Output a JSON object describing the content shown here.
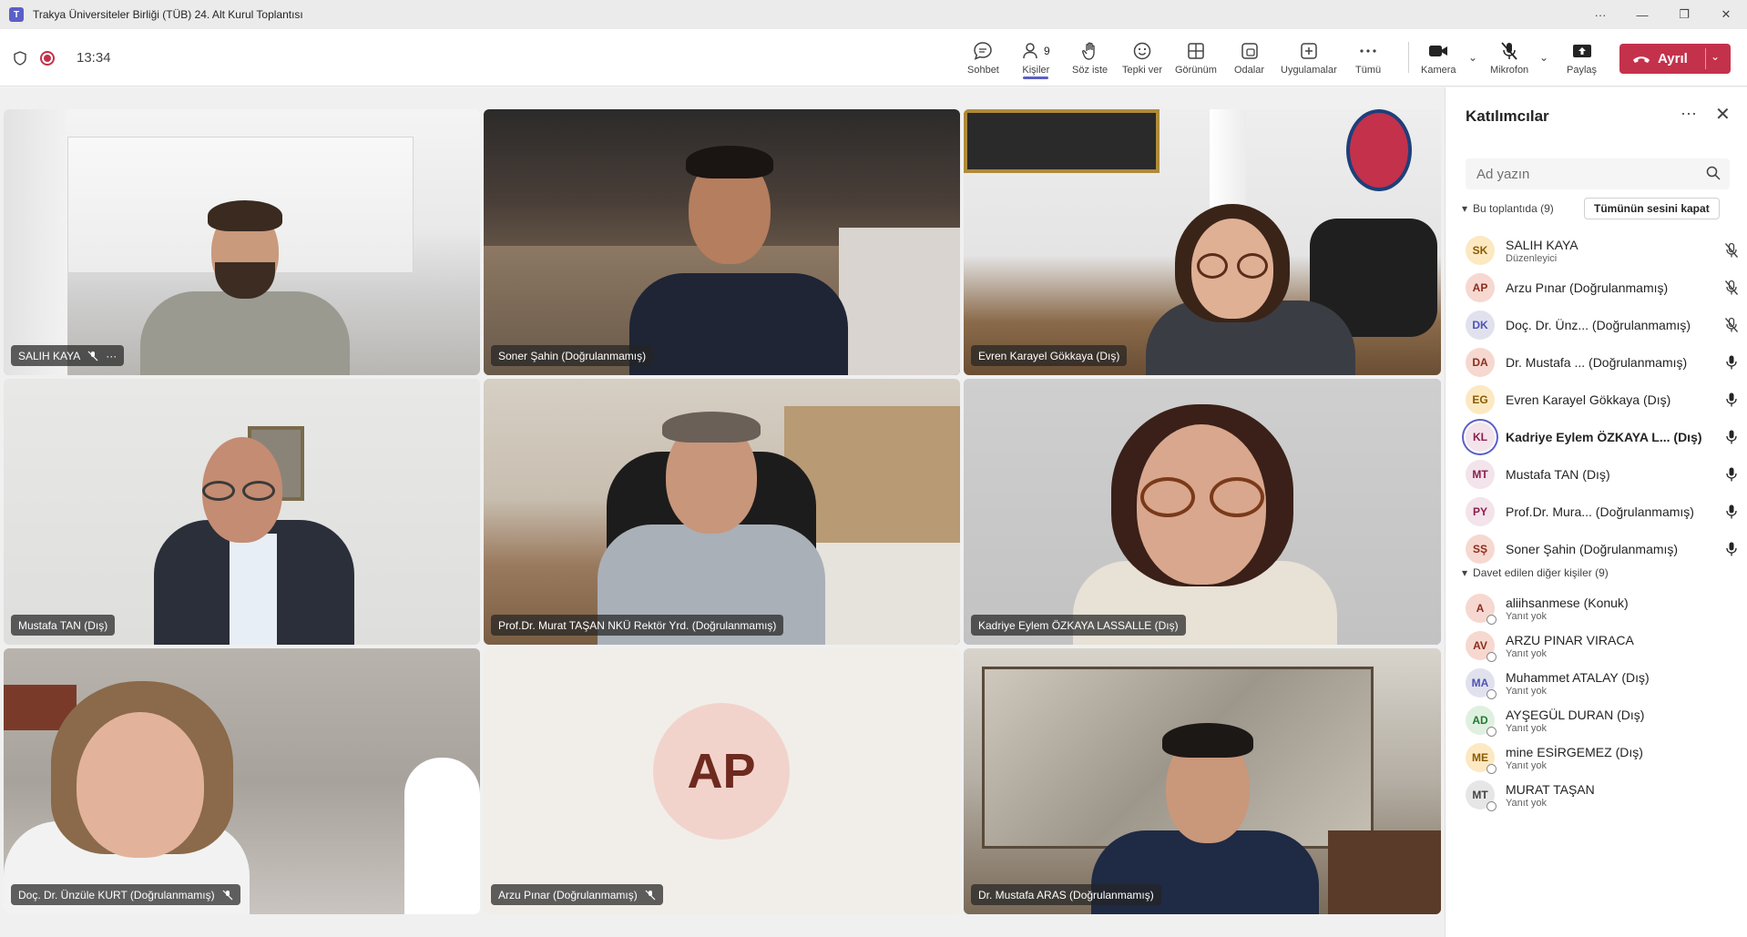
{
  "window": {
    "title": "Trakya Üniversiteler Birliği (TÜB) 24. Alt Kurul Toplantısı",
    "controls": [
      "···",
      "—",
      "❐",
      "✕"
    ]
  },
  "meeting": {
    "timer": "13:34"
  },
  "toolbar": {
    "chat": "Sohbet",
    "people": "Kişiler",
    "people_count": "9",
    "raise_hand": "Söz iste",
    "react": "Tepki ver",
    "view": "Görünüm",
    "rooms": "Odalar",
    "apps": "Uygulamalar",
    "more": "Tümü",
    "camera": "Kamera",
    "mic": "Mikrofon",
    "share": "Paylaş",
    "leave": "Ayrıl"
  },
  "tiles": [
    {
      "name": "SALIH KAYA"
    },
    {
      "name": "Soner Şahin (Doğrulanmamış)"
    },
    {
      "name": "Evren Karayel Gökkaya (Dış)"
    },
    {
      "name": "Mustafa TAN (Dış)"
    },
    {
      "name": "Prof.Dr. Murat TAŞAN NKÜ Rektör Yrd. (Doğrulanmamış)"
    },
    {
      "name": "Kadriye Eylem ÖZKAYA LASSALLE (Dış)"
    },
    {
      "name": "Doç. Dr. Ünzüle KURT (Doğrulanmamış)"
    },
    {
      "name": "Arzu Pınar (Doğrulanmamış)",
      "initials": "AP"
    },
    {
      "name": "Dr. Mustafa ARAS (Doğrulanmamış)"
    }
  ],
  "panel": {
    "title": "Katılımcılar",
    "search_placeholder": "Ad yazın",
    "in_meeting_label": "Bu toplantıda (9)",
    "mute_all": "Tümünün sesini kapat",
    "in_meeting": [
      {
        "initials": "SK",
        "name": "SALIH KAYA",
        "sub": "Düzenleyici",
        "bg": "#fce9c2",
        "fg": "#8a5a00",
        "mic": "muted"
      },
      {
        "initials": "AP",
        "name": "Arzu Pınar (Doğrulanmamış)",
        "bg": "#f6d8d0",
        "fg": "#8a2d1f",
        "mic": "muted"
      },
      {
        "initials": "DK",
        "name": "Doç. Dr. Ünz...  (Doğrulanmamış)",
        "bg": "#e1e1ee",
        "fg": "#4f52b2",
        "mic": "muted"
      },
      {
        "initials": "DA",
        "name": "Dr. Mustafa ...  (Doğrulanmamış)",
        "bg": "#f6d8d0",
        "fg": "#8a2d1f",
        "mic": "on"
      },
      {
        "initials": "EG",
        "name": "Evren Karayel Gökkaya (Dış)",
        "bg": "#fce9c2",
        "fg": "#8a5a00",
        "mic": "on"
      },
      {
        "initials": "KL",
        "name": "Kadriye Eylem ÖZKAYA L... (Dış)",
        "bg": "#f3e3ea",
        "fg": "#8a1f4d",
        "mic": "on",
        "speaking": true
      },
      {
        "initials": "MT",
        "name": "Mustafa TAN (Dış)",
        "bg": "#f3e3ea",
        "fg": "#8a1f4d",
        "mic": "on"
      },
      {
        "initials": "PY",
        "name": "Prof.Dr. Mura... (Doğrulanmamış)",
        "bg": "#f3e3ea",
        "fg": "#8a1f4d",
        "mic": "on"
      },
      {
        "initials": "SŞ",
        "name": "Soner Şahin (Doğrulanmamış)",
        "bg": "#f6d8d0",
        "fg": "#8a2d1f",
        "mic": "on"
      }
    ],
    "invited_label": "Davet edilen diğer kişiler (9)",
    "invited": [
      {
        "initials": "A",
        "name": "aliihsanmese (Konuk)",
        "sub": "Yanıt yok",
        "bg": "#f6d8d0",
        "fg": "#8a2d1f"
      },
      {
        "initials": "AV",
        "name": "ARZU PINAR VIRACA",
        "sub": "Yanıt yok",
        "bg": "#f6d8d0",
        "fg": "#8a2d1f"
      },
      {
        "initials": "MA",
        "name": "Muhammet ATALAY (Dış)",
        "sub": "Yanıt yok",
        "bg": "#e1e1ee",
        "fg": "#4f52b2"
      },
      {
        "initials": "AD",
        "name": "AYŞEGÜL DURAN (Dış)",
        "sub": "Yanıt yok",
        "bg": "#dff0e0",
        "fg": "#1f7a32"
      },
      {
        "initials": "ME",
        "name": "mine ESİRGEMEZ (Dış)",
        "sub": "Yanıt yok",
        "bg": "#fce9c2",
        "fg": "#8a5a00"
      },
      {
        "initials": "MT",
        "name": "MURAT TAŞAN",
        "sub": "Yanıt yok",
        "bg": "#e6e6e6",
        "fg": "#424242"
      }
    ]
  }
}
